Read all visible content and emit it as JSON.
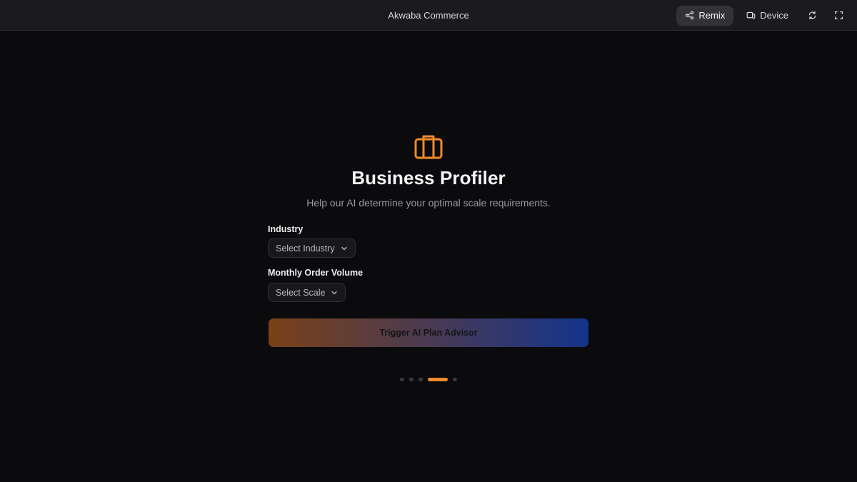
{
  "topbar": {
    "title": "Akwaba Commerce",
    "remix_label": "Remix",
    "device_label": "Device"
  },
  "hero": {
    "icon": "briefcase-icon",
    "title": "Business Profiler",
    "subtitle": "Help our AI determine your optimal scale requirements."
  },
  "form": {
    "industry": {
      "label": "Industry",
      "value": "Select Industry"
    },
    "volume": {
      "label": "Monthly Order Volume",
      "value": "Select Scale"
    },
    "submit_label": "Trigger AI Plan Advisor"
  },
  "pager": {
    "total": 5,
    "active_index": 3
  },
  "colors": {
    "accent": "#f08a2c",
    "gradient_start": "#7a4118",
    "gradient_end": "#14348c",
    "background": "#0b0b0d",
    "topbar": "#1b1b1d"
  }
}
